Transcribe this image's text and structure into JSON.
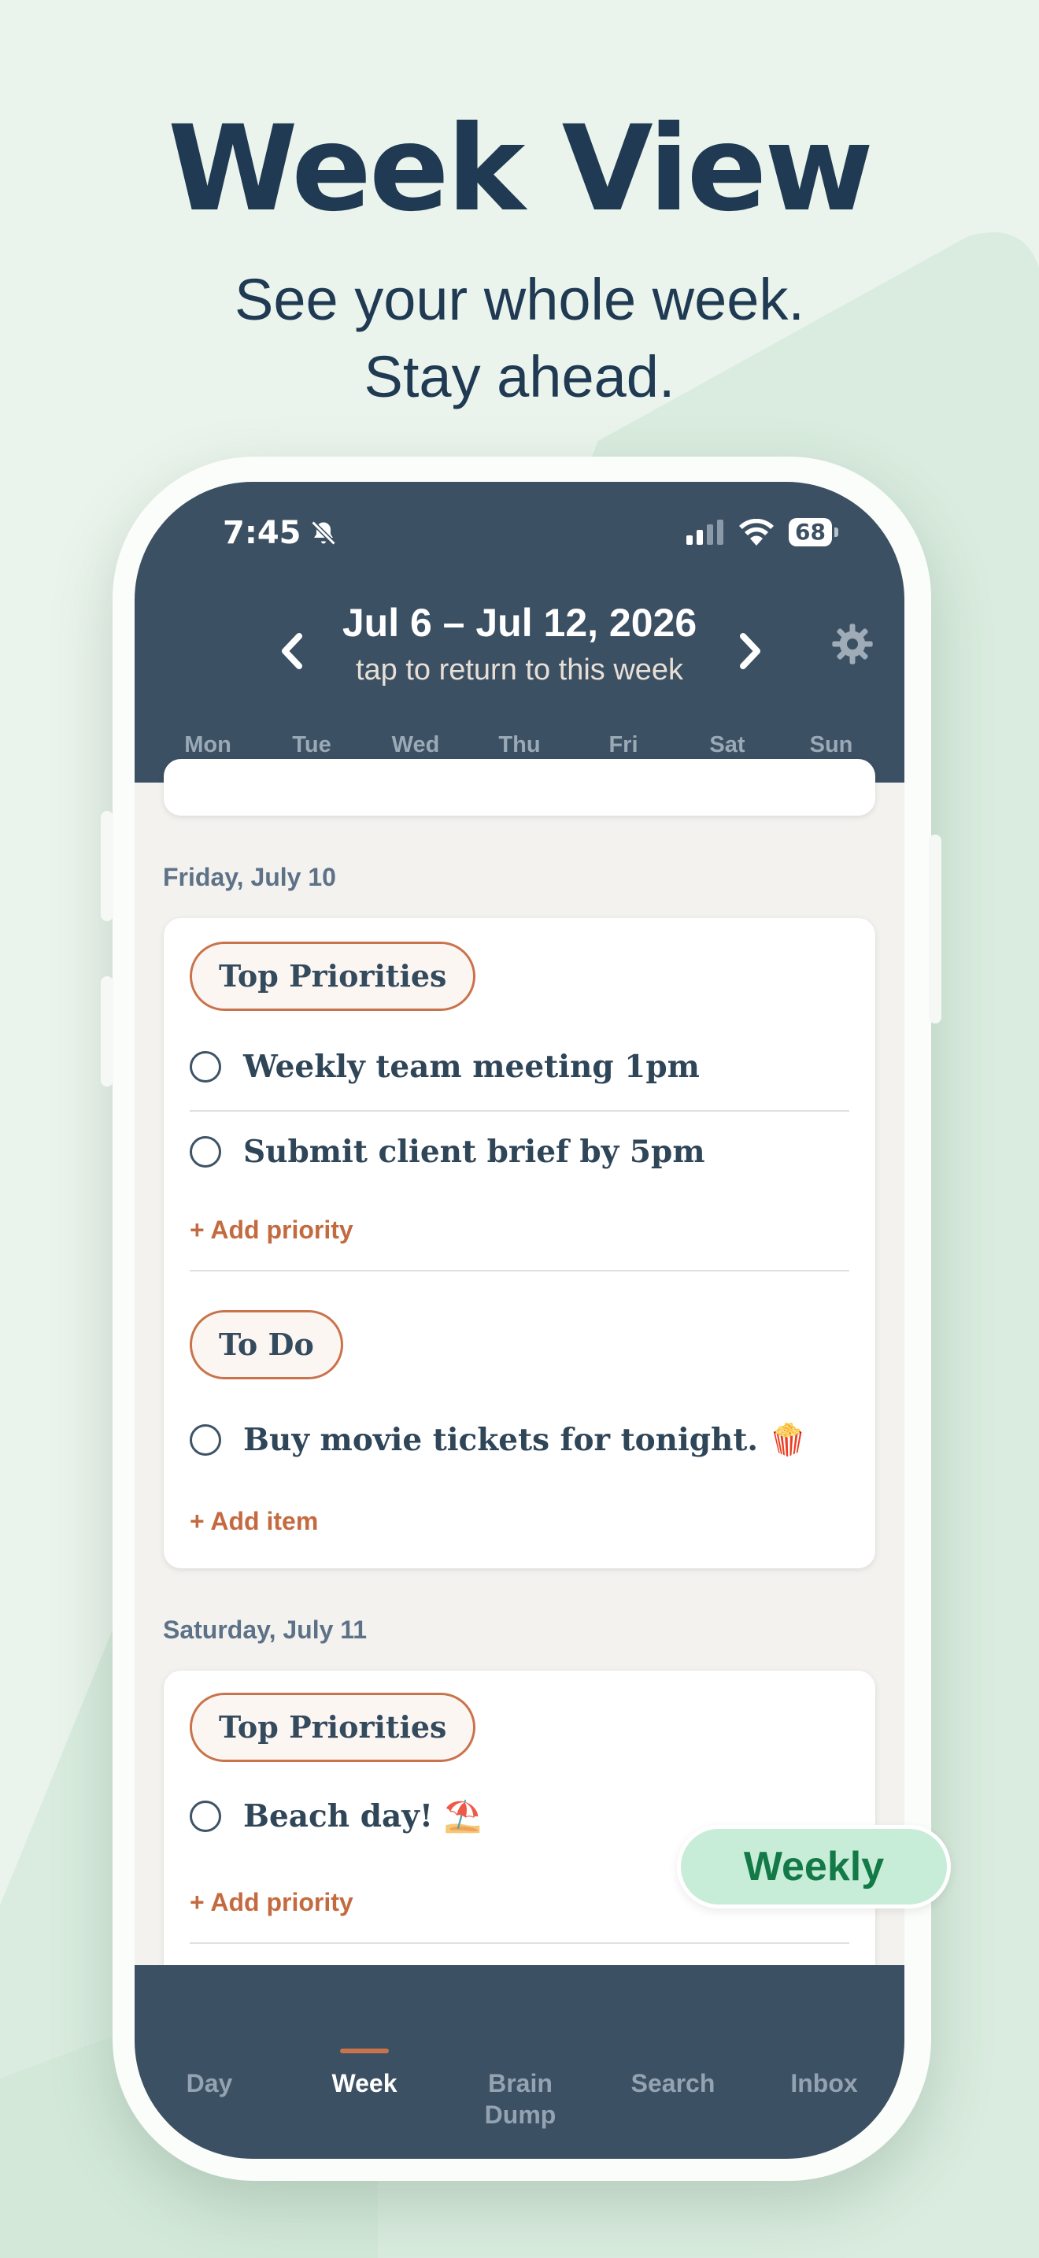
{
  "hero": {
    "title": "Week View",
    "subtitle_line1": "See your whole week.",
    "subtitle_line2": "Stay ahead."
  },
  "status_bar": {
    "time": "7:45",
    "battery": "68",
    "icons": [
      "bell-slash-icon",
      "cellular-signal-icon",
      "wifi-icon",
      "battery-icon"
    ]
  },
  "header": {
    "week_range": "Jul 6 – Jul 12, 2026",
    "hint": "tap to return to this week",
    "prev_icon": "chevron-left-icon",
    "next_icon": "chevron-right-icon",
    "settings_icon": "gear-icon",
    "days": [
      "Mon",
      "Tue",
      "Wed",
      "Thu",
      "Fri",
      "Sat",
      "Sun"
    ]
  },
  "friday": {
    "heading": "Friday, July 10",
    "top_priorities_label": "Top Priorities",
    "priorities": [
      "Weekly team meeting 1pm",
      "Submit client brief by 5pm"
    ],
    "add_priority": "+ Add priority",
    "todo_label": "To Do",
    "todos": [
      "Buy movie tickets for tonight. 🍿"
    ],
    "add_item": "+ Add item"
  },
  "saturday": {
    "heading": "Saturday, July 11",
    "top_priorities_label": "Top Priorities",
    "priorities": [
      "Beach day! ⛱️"
    ],
    "add_priority": "+ Add priority"
  },
  "tabs": {
    "day": "Day",
    "week": "Week",
    "brain_dump_1": "Brain",
    "brain_dump_2": "Dump",
    "search": "Search",
    "inbox": "Inbox"
  },
  "badge": "Weekly",
  "colors": {
    "header_bg": "#3c5063",
    "accent": "#c9734c",
    "badge_bg": "#c7ecd8",
    "badge_text": "#137a47",
    "title": "#1f3a52"
  }
}
